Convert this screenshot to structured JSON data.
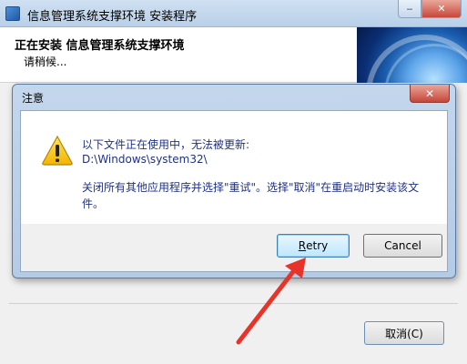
{
  "installer": {
    "title": "信息管理系统支撑环境 安装程序",
    "heading": "正在安装 信息管理系统支撑环境",
    "status": "请稍候...",
    "cancel_label": "取消(C)",
    "controls": {
      "minimize": "‒",
      "close": "✕"
    }
  },
  "dialog": {
    "title": "注意",
    "close_glyph": "✕",
    "message_lines": [
      "以下文件正在使用中，无法被更新:",
      "D:\\Windows\\system32\\",
      "关闭所有其他应用程序并选择\"重试\"。选择\"取消\"在重启动时安装该文",
      "件。"
    ],
    "retry_label": "Retry",
    "retry_mnemonic": "R",
    "retry_rest": "etry",
    "cancel_label": "Cancel"
  },
  "icons": {
    "warning": "warning-icon",
    "arrow": "red-arrow-annotation"
  },
  "colors": {
    "message_text": "#1e3287",
    "arrow": "#e8332a",
    "warning_fill": "#f6c300"
  }
}
